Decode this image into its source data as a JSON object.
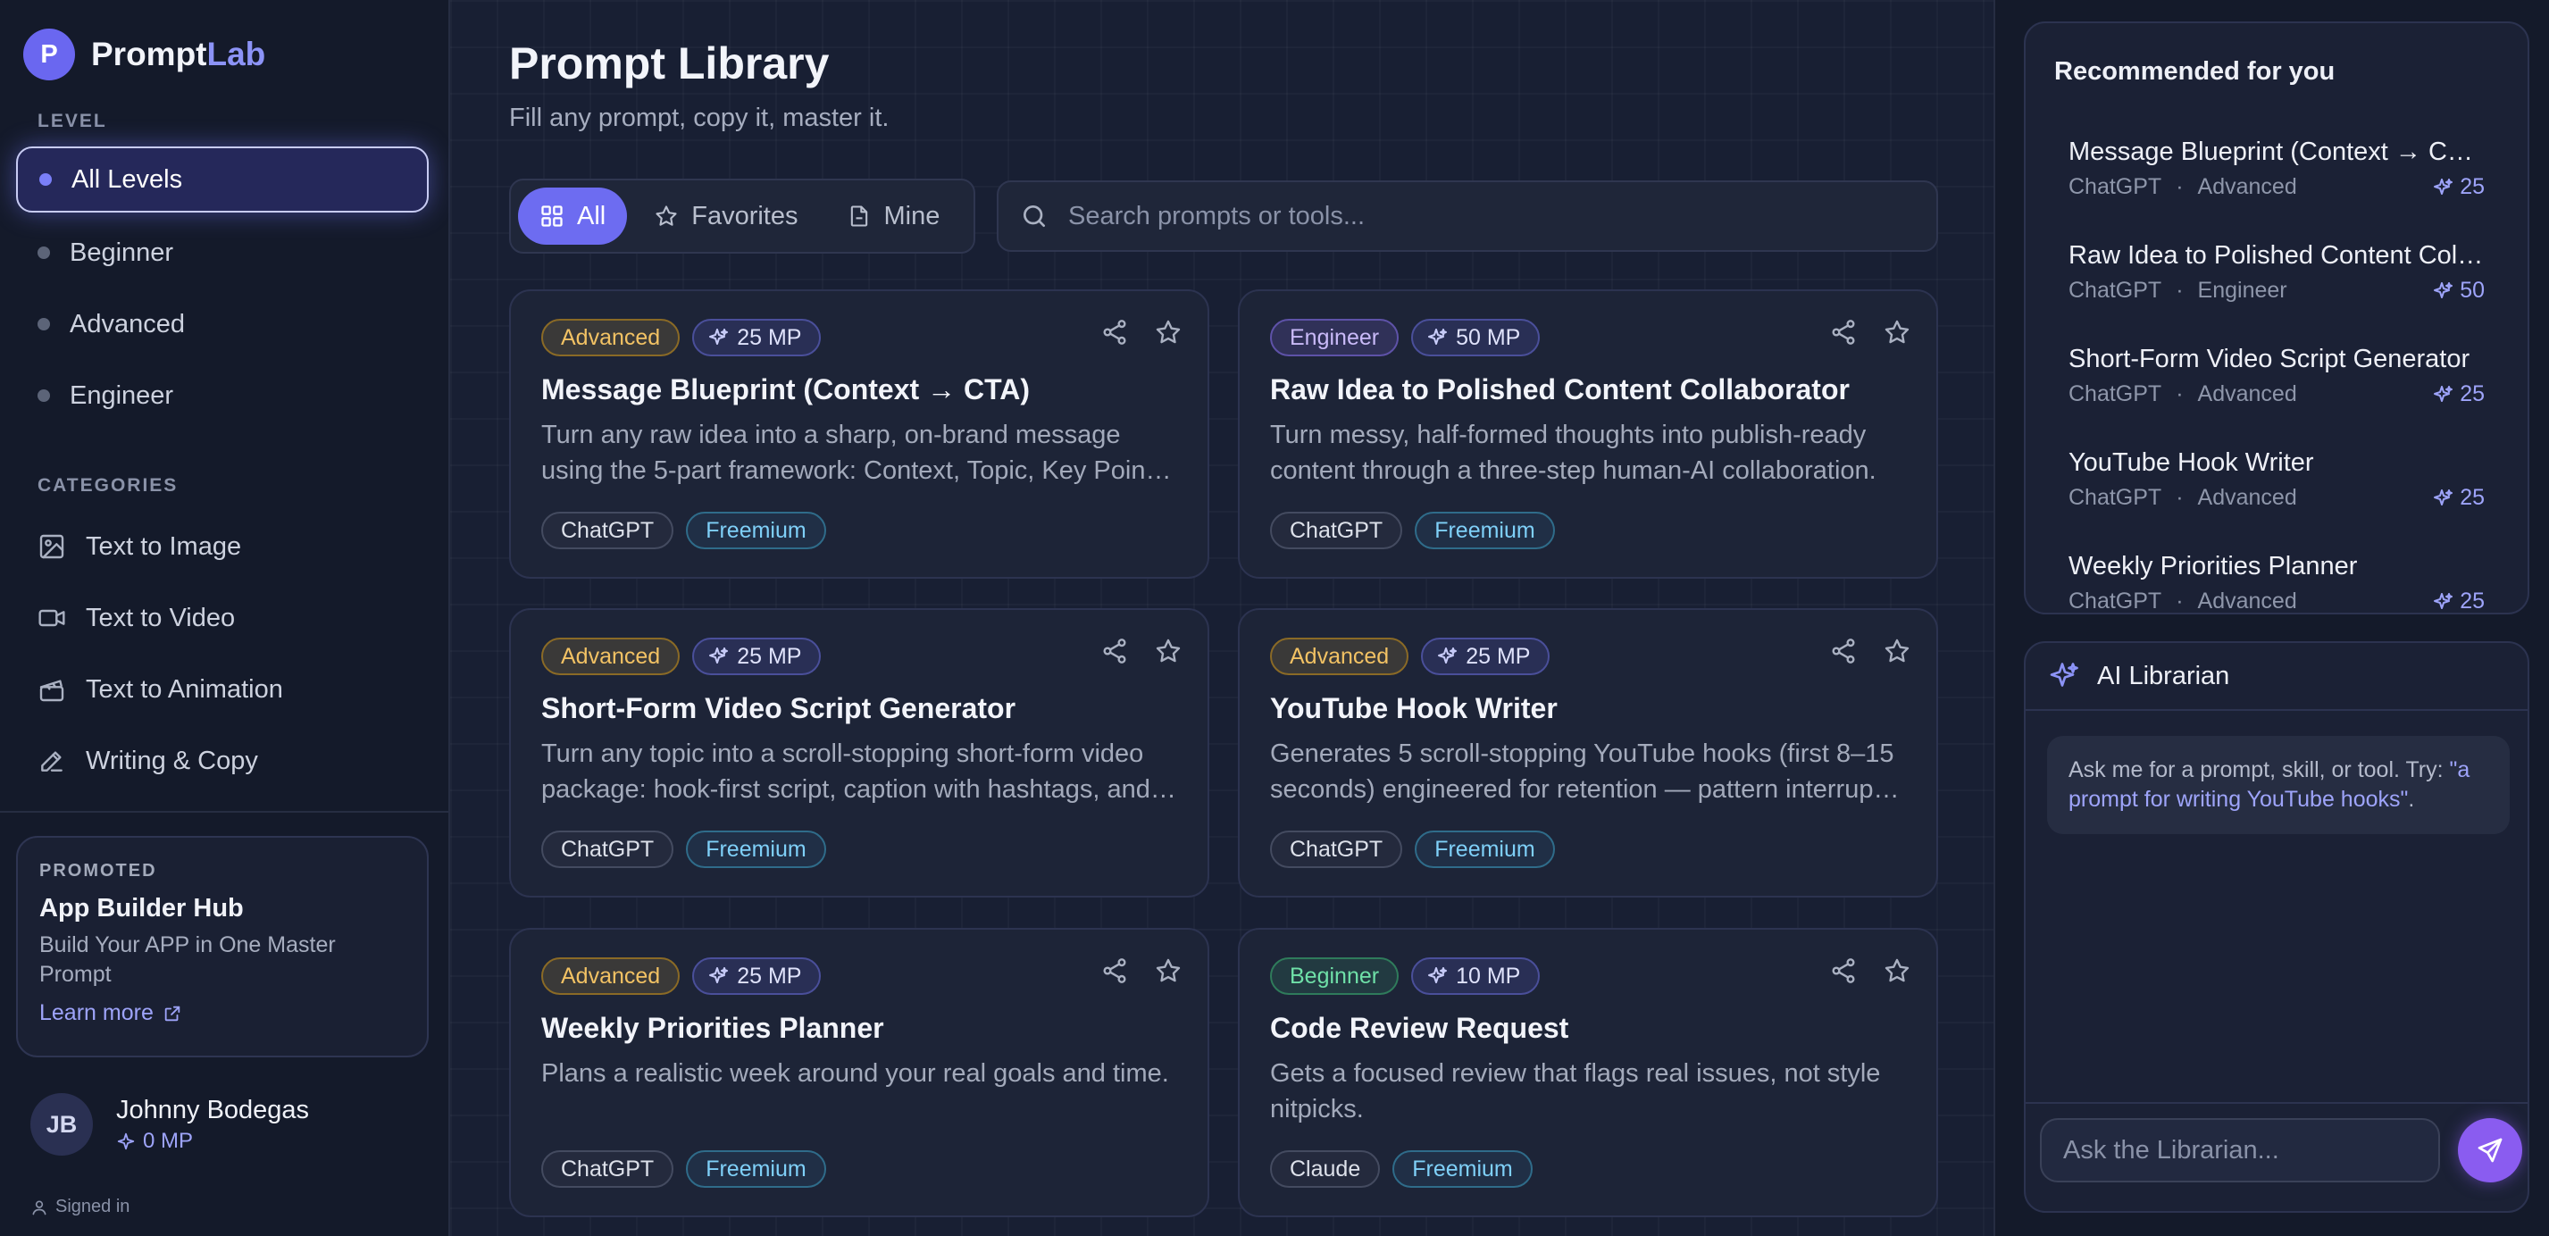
{
  "brand": {
    "logo_letter": "P",
    "name_part1": "Prompt",
    "name_part2": "Lab"
  },
  "sidebar": {
    "level_label": "LEVEL",
    "levels": [
      {
        "label": "All Levels",
        "active": true
      },
      {
        "label": "Beginner"
      },
      {
        "label": "Advanced"
      },
      {
        "label": "Engineer"
      }
    ],
    "categories_label": "CATEGORIES",
    "categories": [
      {
        "label": "Text to Image",
        "icon": "image-icon"
      },
      {
        "label": "Text to Video",
        "icon": "video-icon"
      },
      {
        "label": "Text to Animation",
        "icon": "clapperboard-icon"
      },
      {
        "label": "Writing & Copy",
        "icon": "pencil-icon"
      }
    ],
    "promo": {
      "label": "PROMOTED",
      "title": "App Builder Hub",
      "description": "Build Your APP in One Master Prompt",
      "link": "Learn more"
    },
    "user": {
      "initials": "JB",
      "name": "Johnny Bodegas",
      "mp": "0 MP",
      "status": "Signed in"
    }
  },
  "main": {
    "title": "Prompt Library",
    "subtitle": "Fill any prompt, copy it, master it.",
    "tabs": [
      {
        "label": "All",
        "icon": "grid-icon",
        "active": true
      },
      {
        "label": "Favorites",
        "icon": "star-icon"
      },
      {
        "label": "Mine",
        "icon": "file-icon"
      }
    ],
    "search_placeholder": "Search prompts or tools...",
    "cards": [
      {
        "level": "Advanced",
        "mp": "25 MP",
        "title": "Message Blueprint (Context → CTA)",
        "description": "Turn any raw idea into a sharp, on-brand message using the 5-part framework: Context, Topic, Key Points, Tone and CTA.",
        "tool": "ChatGPT",
        "price": "Freemium"
      },
      {
        "level": "Engineer",
        "mp": "50 MP",
        "title": "Raw Idea to Polished Content Collaborator",
        "description": "Turn messy, half-formed thoughts into publish-ready content through a three-step human-AI collaboration.",
        "tool": "ChatGPT",
        "price": "Freemium"
      },
      {
        "level": "Advanced",
        "mp": "25 MP",
        "title": "Short-Form Video Script Generator",
        "description": "Turn any topic into a scroll-stopping short-form video package: hook-first script, caption with hashtags, and more.",
        "tool": "ChatGPT",
        "price": "Freemium"
      },
      {
        "level": "Advanced",
        "mp": "25 MP",
        "title": "YouTube Hook Writer",
        "description": "Generates 5 scroll-stopping YouTube hooks (first 8–15 seconds) engineered for retention — pattern interrupts and more.",
        "tool": "ChatGPT",
        "price": "Freemium"
      },
      {
        "level": "Advanced",
        "mp": "25 MP",
        "title": "Weekly Priorities Planner",
        "description": "Plans a realistic week around your real goals and time.",
        "tool": "ChatGPT",
        "price": "Freemium"
      },
      {
        "level": "Beginner",
        "mp": "10 MP",
        "title": "Code Review Request",
        "description": "Gets a focused review that flags real issues, not style nitpicks.",
        "tool": "Claude",
        "price": "Freemium"
      }
    ]
  },
  "recommended": {
    "title": "Recommended for you",
    "items": [
      {
        "name": "Message Blueprint (Context → CTA)",
        "tool": "ChatGPT",
        "level": "Advanced",
        "mp": "25"
      },
      {
        "name": "Raw Idea to Polished Content Collaborator",
        "tool": "ChatGPT",
        "level": "Engineer",
        "mp": "50"
      },
      {
        "name": "Short-Form Video Script Generator",
        "tool": "ChatGPT",
        "level": "Advanced",
        "mp": "25"
      },
      {
        "name": "YouTube Hook Writer",
        "tool": "ChatGPT",
        "level": "Advanced",
        "mp": "25"
      },
      {
        "name": "Weekly Priorities Planner",
        "tool": "ChatGPT",
        "level": "Advanced",
        "mp": "25"
      }
    ],
    "separator": "·"
  },
  "librarian": {
    "title": "AI Librarian",
    "message_prefix": "Ask me for a prompt, skill, or tool. Try: ",
    "message_example": "\"a prompt for writing YouTube hooks\"",
    "message_suffix": ".",
    "input_placeholder": "Ask the Librarian..."
  },
  "colors": {
    "accent": "#6d6cf1",
    "advanced": "#f2c264",
    "engineer": "#c9baf8",
    "beginner": "#6fe0a8",
    "freemium": "#7fd0f8"
  }
}
